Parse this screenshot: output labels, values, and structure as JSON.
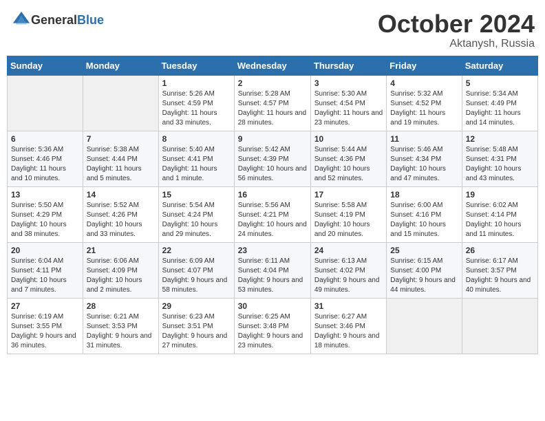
{
  "header": {
    "logo_general": "General",
    "logo_blue": "Blue",
    "month": "October 2024",
    "location": "Aktanysh, Russia"
  },
  "weekdays": [
    "Sunday",
    "Monday",
    "Tuesday",
    "Wednesday",
    "Thursday",
    "Friday",
    "Saturday"
  ],
  "weeks": [
    [
      {
        "day": "",
        "sunrise": "",
        "sunset": "",
        "daylight": ""
      },
      {
        "day": "",
        "sunrise": "",
        "sunset": "",
        "daylight": ""
      },
      {
        "day": "1",
        "sunrise": "Sunrise: 5:26 AM",
        "sunset": "Sunset: 4:59 PM",
        "daylight": "Daylight: 11 hours and 33 minutes."
      },
      {
        "day": "2",
        "sunrise": "Sunrise: 5:28 AM",
        "sunset": "Sunset: 4:57 PM",
        "daylight": "Daylight: 11 hours and 28 minutes."
      },
      {
        "day": "3",
        "sunrise": "Sunrise: 5:30 AM",
        "sunset": "Sunset: 4:54 PM",
        "daylight": "Daylight: 11 hours and 23 minutes."
      },
      {
        "day": "4",
        "sunrise": "Sunrise: 5:32 AM",
        "sunset": "Sunset: 4:52 PM",
        "daylight": "Daylight: 11 hours and 19 minutes."
      },
      {
        "day": "5",
        "sunrise": "Sunrise: 5:34 AM",
        "sunset": "Sunset: 4:49 PM",
        "daylight": "Daylight: 11 hours and 14 minutes."
      }
    ],
    [
      {
        "day": "6",
        "sunrise": "Sunrise: 5:36 AM",
        "sunset": "Sunset: 4:46 PM",
        "daylight": "Daylight: 11 hours and 10 minutes."
      },
      {
        "day": "7",
        "sunrise": "Sunrise: 5:38 AM",
        "sunset": "Sunset: 4:44 PM",
        "daylight": "Daylight: 11 hours and 5 minutes."
      },
      {
        "day": "8",
        "sunrise": "Sunrise: 5:40 AM",
        "sunset": "Sunset: 4:41 PM",
        "daylight": "Daylight: 11 hours and 1 minute."
      },
      {
        "day": "9",
        "sunrise": "Sunrise: 5:42 AM",
        "sunset": "Sunset: 4:39 PM",
        "daylight": "Daylight: 10 hours and 56 minutes."
      },
      {
        "day": "10",
        "sunrise": "Sunrise: 5:44 AM",
        "sunset": "Sunset: 4:36 PM",
        "daylight": "Daylight: 10 hours and 52 minutes."
      },
      {
        "day": "11",
        "sunrise": "Sunrise: 5:46 AM",
        "sunset": "Sunset: 4:34 PM",
        "daylight": "Daylight: 10 hours and 47 minutes."
      },
      {
        "day": "12",
        "sunrise": "Sunrise: 5:48 AM",
        "sunset": "Sunset: 4:31 PM",
        "daylight": "Daylight: 10 hours and 43 minutes."
      }
    ],
    [
      {
        "day": "13",
        "sunrise": "Sunrise: 5:50 AM",
        "sunset": "Sunset: 4:29 PM",
        "daylight": "Daylight: 10 hours and 38 minutes."
      },
      {
        "day": "14",
        "sunrise": "Sunrise: 5:52 AM",
        "sunset": "Sunset: 4:26 PM",
        "daylight": "Daylight: 10 hours and 33 minutes."
      },
      {
        "day": "15",
        "sunrise": "Sunrise: 5:54 AM",
        "sunset": "Sunset: 4:24 PM",
        "daylight": "Daylight: 10 hours and 29 minutes."
      },
      {
        "day": "16",
        "sunrise": "Sunrise: 5:56 AM",
        "sunset": "Sunset: 4:21 PM",
        "daylight": "Daylight: 10 hours and 24 minutes."
      },
      {
        "day": "17",
        "sunrise": "Sunrise: 5:58 AM",
        "sunset": "Sunset: 4:19 PM",
        "daylight": "Daylight: 10 hours and 20 minutes."
      },
      {
        "day": "18",
        "sunrise": "Sunrise: 6:00 AM",
        "sunset": "Sunset: 4:16 PM",
        "daylight": "Daylight: 10 hours and 15 minutes."
      },
      {
        "day": "19",
        "sunrise": "Sunrise: 6:02 AM",
        "sunset": "Sunset: 4:14 PM",
        "daylight": "Daylight: 10 hours and 11 minutes."
      }
    ],
    [
      {
        "day": "20",
        "sunrise": "Sunrise: 6:04 AM",
        "sunset": "Sunset: 4:11 PM",
        "daylight": "Daylight: 10 hours and 7 minutes."
      },
      {
        "day": "21",
        "sunrise": "Sunrise: 6:06 AM",
        "sunset": "Sunset: 4:09 PM",
        "daylight": "Daylight: 10 hours and 2 minutes."
      },
      {
        "day": "22",
        "sunrise": "Sunrise: 6:09 AM",
        "sunset": "Sunset: 4:07 PM",
        "daylight": "Daylight: 9 hours and 58 minutes."
      },
      {
        "day": "23",
        "sunrise": "Sunrise: 6:11 AM",
        "sunset": "Sunset: 4:04 PM",
        "daylight": "Daylight: 9 hours and 53 minutes."
      },
      {
        "day": "24",
        "sunrise": "Sunrise: 6:13 AM",
        "sunset": "Sunset: 4:02 PM",
        "daylight": "Daylight: 9 hours and 49 minutes."
      },
      {
        "day": "25",
        "sunrise": "Sunrise: 6:15 AM",
        "sunset": "Sunset: 4:00 PM",
        "daylight": "Daylight: 9 hours and 44 minutes."
      },
      {
        "day": "26",
        "sunrise": "Sunrise: 6:17 AM",
        "sunset": "Sunset: 3:57 PM",
        "daylight": "Daylight: 9 hours and 40 minutes."
      }
    ],
    [
      {
        "day": "27",
        "sunrise": "Sunrise: 6:19 AM",
        "sunset": "Sunset: 3:55 PM",
        "daylight": "Daylight: 9 hours and 36 minutes."
      },
      {
        "day": "28",
        "sunrise": "Sunrise: 6:21 AM",
        "sunset": "Sunset: 3:53 PM",
        "daylight": "Daylight: 9 hours and 31 minutes."
      },
      {
        "day": "29",
        "sunrise": "Sunrise: 6:23 AM",
        "sunset": "Sunset: 3:51 PM",
        "daylight": "Daylight: 9 hours and 27 minutes."
      },
      {
        "day": "30",
        "sunrise": "Sunrise: 6:25 AM",
        "sunset": "Sunset: 3:48 PM",
        "daylight": "Daylight: 9 hours and 23 minutes."
      },
      {
        "day": "31",
        "sunrise": "Sunrise: 6:27 AM",
        "sunset": "Sunset: 3:46 PM",
        "daylight": "Daylight: 9 hours and 18 minutes."
      },
      {
        "day": "",
        "sunrise": "",
        "sunset": "",
        "daylight": ""
      },
      {
        "day": "",
        "sunrise": "",
        "sunset": "",
        "daylight": ""
      }
    ]
  ]
}
